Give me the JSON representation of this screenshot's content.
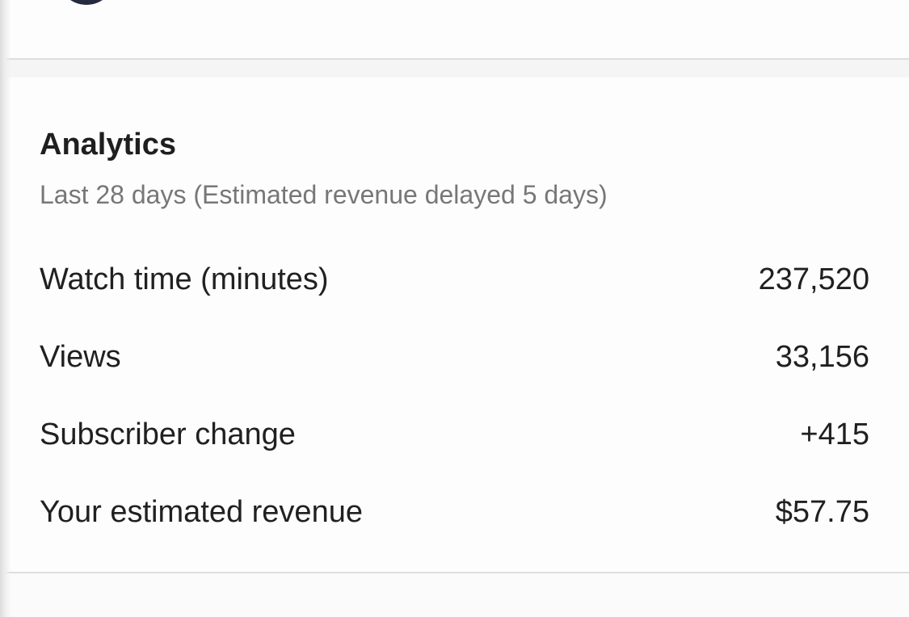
{
  "analytics": {
    "title": "Analytics",
    "subtitle": "Last 28 days (Estimated revenue delayed 5 days)",
    "metrics": [
      {
        "label": "Watch time (minutes)",
        "value": "237,520"
      },
      {
        "label": "Views",
        "value": "33,156"
      },
      {
        "label": "Subscriber change",
        "value": "+415"
      },
      {
        "label": "Your estimated revenue",
        "value": "$57.75"
      }
    ]
  }
}
